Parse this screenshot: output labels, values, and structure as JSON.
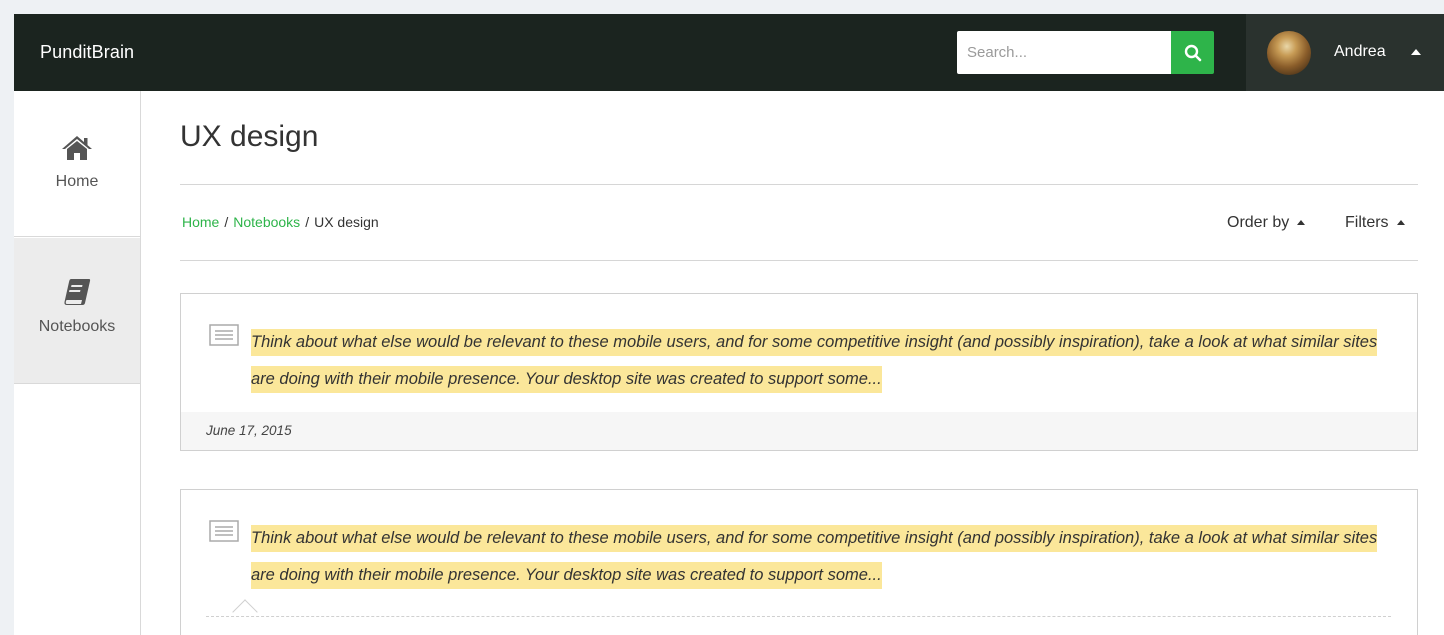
{
  "header": {
    "brand": "PunditBrain",
    "search_placeholder": "Search...",
    "user_name": "Andrea"
  },
  "sidebar": {
    "items": [
      {
        "label": "Home",
        "icon": "home-icon"
      },
      {
        "label": "Notebooks",
        "icon": "notebook-icon"
      }
    ]
  },
  "main": {
    "title": "UX design",
    "breadcrumb": {
      "home": "Home",
      "sep1": "/",
      "notebooks": "Notebooks",
      "sep2": "/",
      "current": "UX design"
    },
    "order_by_label": "Order by",
    "filters_label": "Filters",
    "cards": [
      {
        "excerpt": "Think about what else would be relevant to these mobile users, and for some competitive insight (and possibly inspiration), take a look at what similar sites are doing with their mobile presence. Your desktop site was created to support some...",
        "date": "June 17, 2015"
      },
      {
        "excerpt": "Think about what else would be relevant to these mobile users, and for some competitive insight (and possibly inspiration), take a look at what similar sites are doing with their mobile presence. Your desktop site was created to support some..."
      }
    ]
  },
  "colors": {
    "topbar": "#1b241f",
    "accent_green": "#2eb44a",
    "highlight": "#fbe79a"
  }
}
